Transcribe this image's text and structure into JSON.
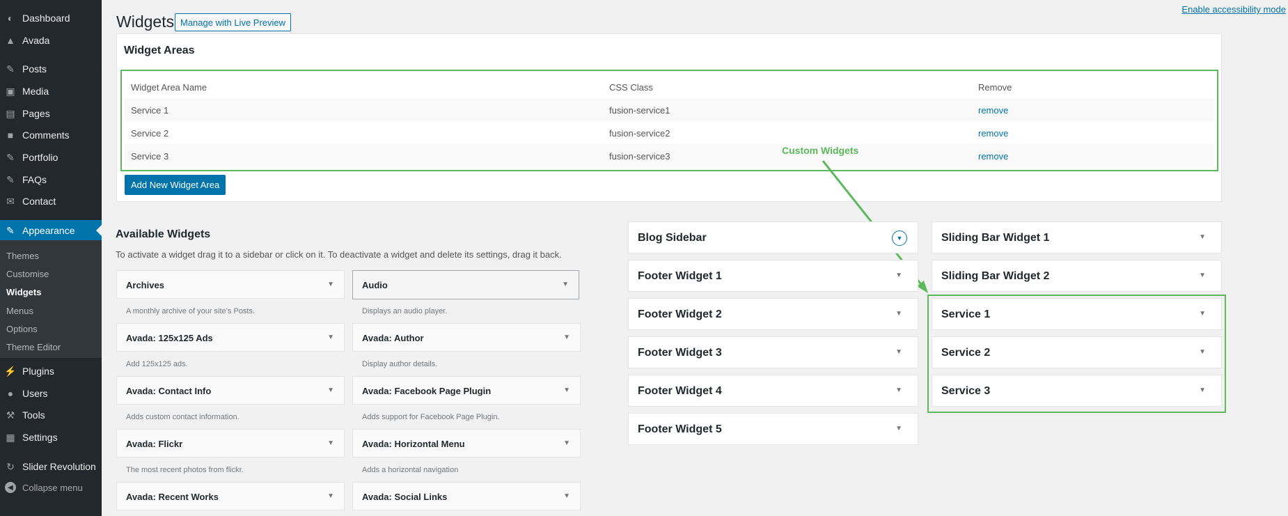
{
  "menu": {
    "items": [
      {
        "label": "Dashboard",
        "icon": "dashboard-icon"
      },
      {
        "label": "Avada",
        "icon": "avada-icon"
      },
      {
        "label": "Posts",
        "icon": "pin-icon"
      },
      {
        "label": "Media",
        "icon": "media-icon"
      },
      {
        "label": "Pages",
        "icon": "page-icon"
      },
      {
        "label": "Comments",
        "icon": "comment-icon"
      },
      {
        "label": "Portfolio",
        "icon": "pin-icon"
      },
      {
        "label": "FAQs",
        "icon": "pin-icon"
      },
      {
        "label": "Contact",
        "icon": "mail-icon"
      },
      {
        "label": "Appearance",
        "icon": "brush-icon"
      },
      {
        "label": "Plugins",
        "icon": "plug-icon"
      },
      {
        "label": "Users",
        "icon": "user-icon"
      },
      {
        "label": "Tools",
        "icon": "wrench-icon"
      },
      {
        "label": "Settings",
        "icon": "settings-icon"
      },
      {
        "label": "Slider Revolution",
        "icon": "refresh-icon"
      }
    ],
    "submenu": [
      "Themes",
      "Customise",
      "Widgets",
      "Menus",
      "Options",
      "Theme Editor"
    ],
    "collapse_label": "Collapse menu"
  },
  "header": {
    "title": "Widgets",
    "live_preview_label": "Manage with Live Preview",
    "accessibility_link": "Enable accessibility mode"
  },
  "widget_areas": {
    "title": "Widget Areas",
    "columns": [
      "Widget Area Name",
      "CSS Class",
      "Remove"
    ],
    "rows": [
      {
        "name": "Service 1",
        "css": "fusion-service1",
        "action": "remove"
      },
      {
        "name": "Service 2",
        "css": "fusion-service2",
        "action": "remove"
      },
      {
        "name": "Service 3",
        "css": "fusion-service3",
        "action": "remove"
      }
    ],
    "add_button": "Add New Widget Area"
  },
  "annotation": {
    "label": "Custom Widgets",
    "color": "#5cb85c"
  },
  "available": {
    "title": "Available Widgets",
    "description": "To activate a widget drag it to a sidebar or click on it. To deactivate a widget and delete its settings, drag it back.",
    "widgets": [
      {
        "name": "Archives",
        "desc": "A monthly archive of your site’s Posts."
      },
      {
        "name": "Audio",
        "desc": "Displays an audio player."
      },
      {
        "name": "Avada: 125x125 Ads",
        "desc": "Add 125x125 ads."
      },
      {
        "name": "Avada: Author",
        "desc": "Display author details."
      },
      {
        "name": "Avada: Contact Info",
        "desc": "Adds custom contact information."
      },
      {
        "name": "Avada: Facebook Page Plugin",
        "desc": "Adds support for Facebook Page Plugin."
      },
      {
        "name": "Avada: Flickr",
        "desc": "The most recent photos from flickr."
      },
      {
        "name": "Avada: Horizontal Menu",
        "desc": "Adds a horizontal navigation"
      },
      {
        "name": "Avada: Recent Works",
        "desc": ""
      },
      {
        "name": "Avada: Social Links",
        "desc": ""
      }
    ]
  },
  "sidebars": {
    "left": [
      "Blog Sidebar",
      "Footer Widget 1",
      "Footer Widget 2",
      "Footer Widget 3",
      "Footer Widget 4",
      "Footer Widget 5"
    ],
    "right": [
      "Sliding Bar Widget 1",
      "Sliding Bar Widget 2",
      "Service 1",
      "Service 2",
      "Service 3"
    ]
  },
  "colors": {
    "admin_bar": "#23282d",
    "accent": "#0073aa"
  }
}
